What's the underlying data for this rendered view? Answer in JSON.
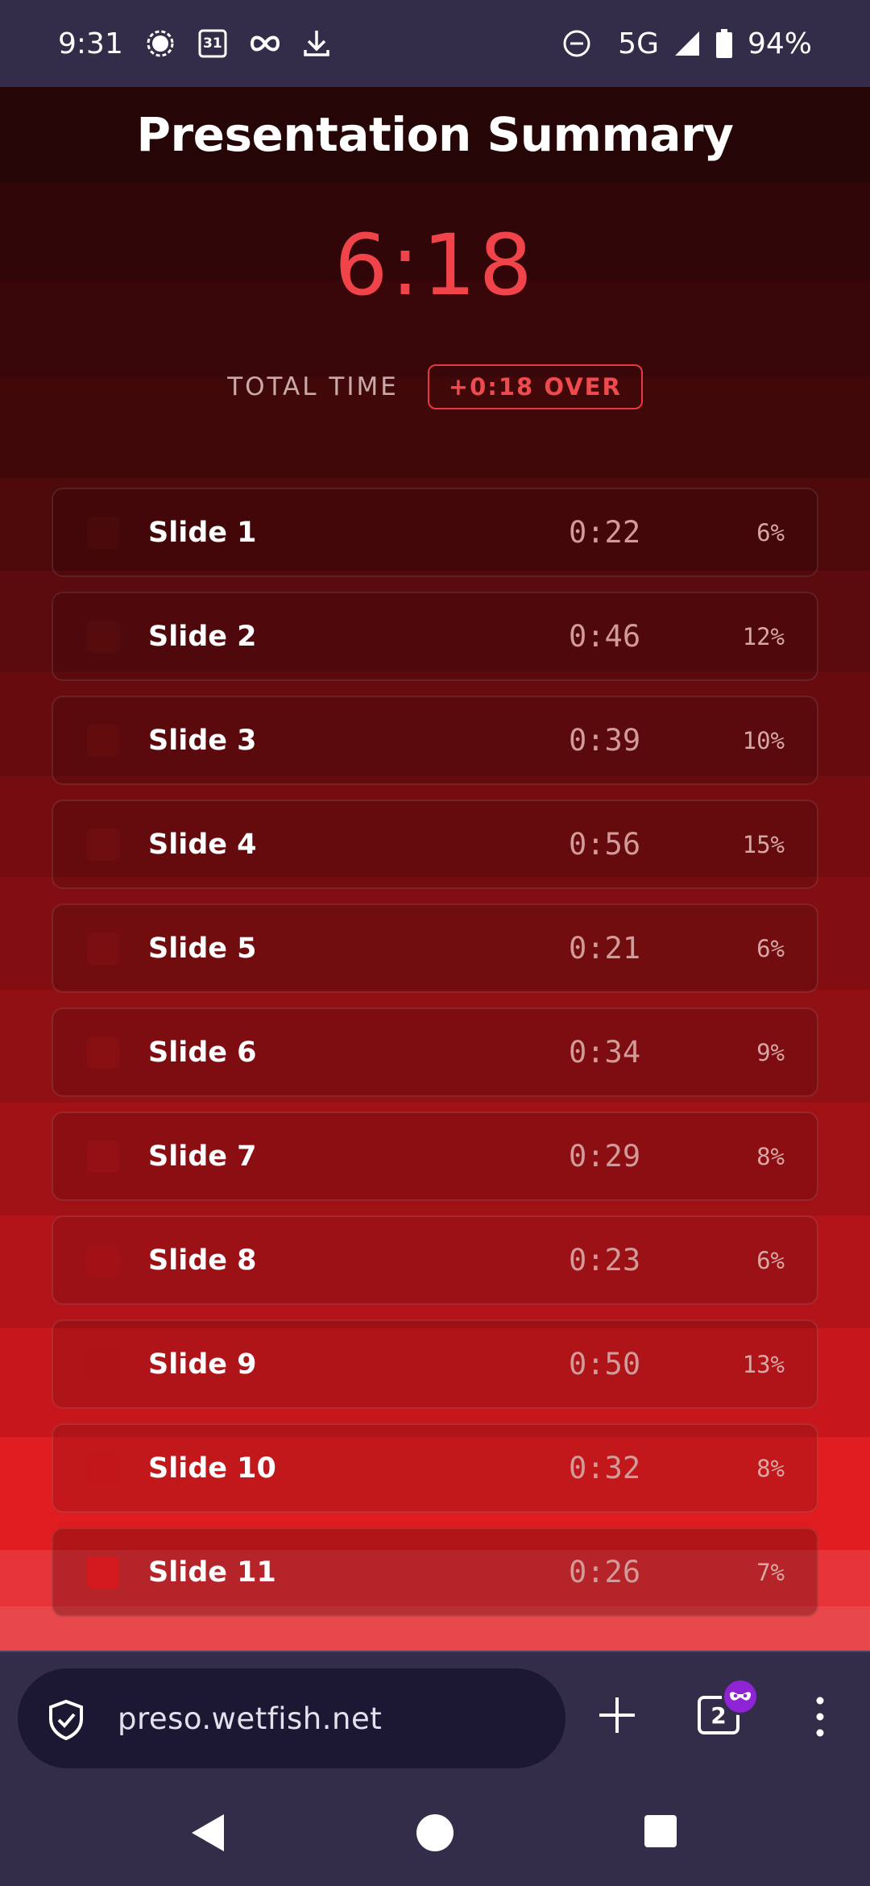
{
  "status_bar": {
    "time": "9:31",
    "network": "5G",
    "battery": "94%",
    "calendar_day": "31",
    "icons": [
      "signal-chat-icon",
      "calendar-icon",
      "infinity-icon",
      "download-icon",
      "do-not-disturb-icon",
      "cell-signal-icon",
      "battery-icon"
    ]
  },
  "header": {
    "title": "Presentation Summary"
  },
  "summary": {
    "total_time": "6:18",
    "total_label": "TOTAL TIME",
    "over_badge": "+0:18 OVER",
    "accent_color": "#f0444a"
  },
  "slides": [
    {
      "name": "Slide 1",
      "time": "0:22",
      "percent": "6%",
      "color": "#4a0a0c"
    },
    {
      "name": "Slide 2",
      "time": "0:46",
      "percent": "12%",
      "color": "#560b0d"
    },
    {
      "name": "Slide 3",
      "time": "0:39",
      "percent": "10%",
      "color": "#620c0e"
    },
    {
      "name": "Slide 4",
      "time": "0:56",
      "percent": "15%",
      "color": "#6e0d10"
    },
    {
      "name": "Slide 5",
      "time": "0:21",
      "percent": "6%",
      "color": "#7a0e11"
    },
    {
      "name": "Slide 6",
      "time": "0:34",
      "percent": "9%",
      "color": "#870f12"
    },
    {
      "name": "Slide 7",
      "time": "0:29",
      "percent": "8%",
      "color": "#941014"
    },
    {
      "name": "Slide 8",
      "time": "0:23",
      "percent": "6%",
      "color": "#a11116"
    },
    {
      "name": "Slide 9",
      "time": "0:50",
      "percent": "13%",
      "color": "#ae1318"
    },
    {
      "name": "Slide 10",
      "time": "0:32",
      "percent": "8%",
      "color": "#c2161b"
    },
    {
      "name": "Slide 11",
      "time": "0:26",
      "percent": "7%",
      "color": "#d4191f"
    }
  ],
  "browser": {
    "url": "preso.wetfish.net",
    "tab_count": "2"
  }
}
